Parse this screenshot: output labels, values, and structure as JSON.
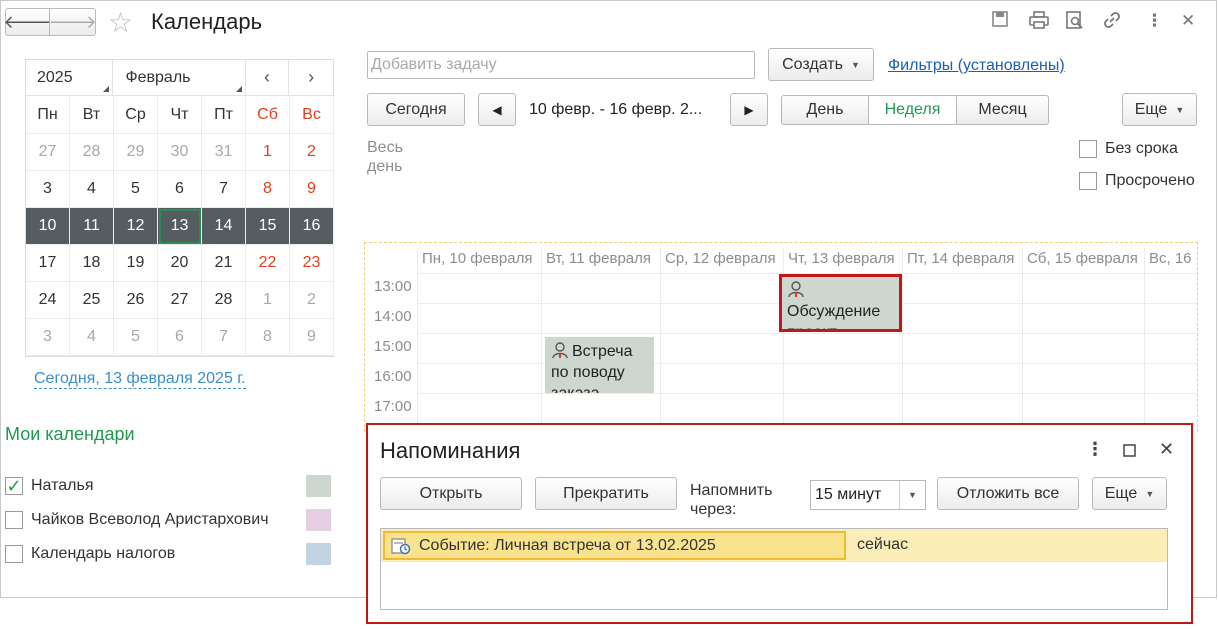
{
  "window": {
    "title": "Календарь"
  },
  "mini_calendar": {
    "year": "2025",
    "month": "Февраль",
    "weekdays": [
      "Пн",
      "Вт",
      "Ср",
      "Чт",
      "Пт",
      "Сб",
      "Вс"
    ],
    "weeks": [
      [
        "27",
        "28",
        "29",
        "30",
        "31",
        "1",
        "2"
      ],
      [
        "3",
        "4",
        "5",
        "6",
        "7",
        "8",
        "9"
      ],
      [
        "10",
        "11",
        "12",
        "13",
        "14",
        "15",
        "16"
      ],
      [
        "17",
        "18",
        "19",
        "20",
        "21",
        "22",
        "23"
      ],
      [
        "24",
        "25",
        "26",
        "27",
        "28",
        "1",
        "2"
      ],
      [
        "3",
        "4",
        "5",
        "6",
        "7",
        "8",
        "9"
      ]
    ],
    "today_link": "Сегодня, 13 февраля 2025 г."
  },
  "my_calendars": {
    "title": "Мои календари",
    "items": [
      {
        "label": "Наталья",
        "checked": true,
        "color": "#cdd7cf"
      },
      {
        "label": "Чайков Всеволод Аристархович",
        "checked": false,
        "color": "#e3cfe1"
      },
      {
        "label": "Календарь налогов",
        "checked": false,
        "color": "#c3d3e2"
      }
    ]
  },
  "toolbar": {
    "task_placeholder": "Добавить задачу",
    "create_button": "Создать",
    "filters_link": "Фильтры (установлены)",
    "today_button": "Сегодня",
    "period": "10 февр. - 16 февр. 2...",
    "view_day": "День",
    "view_week": "Неделя",
    "view_month": "Месяц",
    "more_button": "Еще"
  },
  "all_day_label": "Весь день",
  "filters": {
    "no_deadline": "Без срока",
    "overdue": "Просрочено"
  },
  "week": {
    "days": [
      "Пн, 10 февраля",
      "Вт, 11 февраля",
      "Ср, 12 февраля",
      "Чт, 13 февраля",
      "Пт, 14 февраля",
      "Сб, 15 февраля",
      "Вс, 16"
    ],
    "hours": [
      "13:00",
      "14:00",
      "15:00",
      "16:00",
      "17:00"
    ],
    "events": [
      {
        "text": "Обсуждение проект",
        "day": "Чт, 13 февраля"
      },
      {
        "text": "Встреча по поводу заказа",
        "day": "Вт, 11 февраля"
      }
    ]
  },
  "reminders": {
    "title": "Напоминания",
    "open_button": "Открыть",
    "stop_button": "Прекратить",
    "remind_label": "Напомнить через:",
    "interval_value": "15 минут",
    "postpone_button": "Отложить все",
    "more_button": "Еще",
    "items": [
      {
        "subject": "Событие: Личная встреча от 13.02.2025",
        "when": "сейчас"
      }
    ]
  }
}
